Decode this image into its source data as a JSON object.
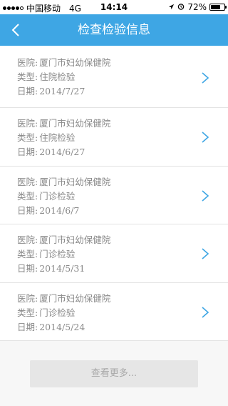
{
  "status_bar": {
    "carrier": "中国移动",
    "network": "4G",
    "time": "14:14",
    "battery_percent": "72%",
    "battery_level": 0.72
  },
  "nav": {
    "title": "检查检验信息"
  },
  "labels": {
    "hospital": "医院:",
    "type": "类型:",
    "date": "日期:"
  },
  "records": [
    {
      "hospital": "厦门市妇幼保健院",
      "type": "住院检验",
      "date": "2014/7/27"
    },
    {
      "hospital": "厦门市妇幼保健院",
      "type": "住院检验",
      "date": "2014/6/27"
    },
    {
      "hospital": "厦门市妇幼保健院",
      "type": "门诊检验",
      "date": "2014/6/7"
    },
    {
      "hospital": "厦门市妇幼保健院",
      "type": "门诊检验",
      "date": "2014/5/31"
    },
    {
      "hospital": "厦门市妇幼保健院",
      "type": "门诊检验",
      "date": "2014/5/24"
    }
  ],
  "more_button": {
    "label": "查看更多..."
  },
  "colors": {
    "nav_background": "#3ea6e4",
    "chevron": "#3ea6e4"
  }
}
